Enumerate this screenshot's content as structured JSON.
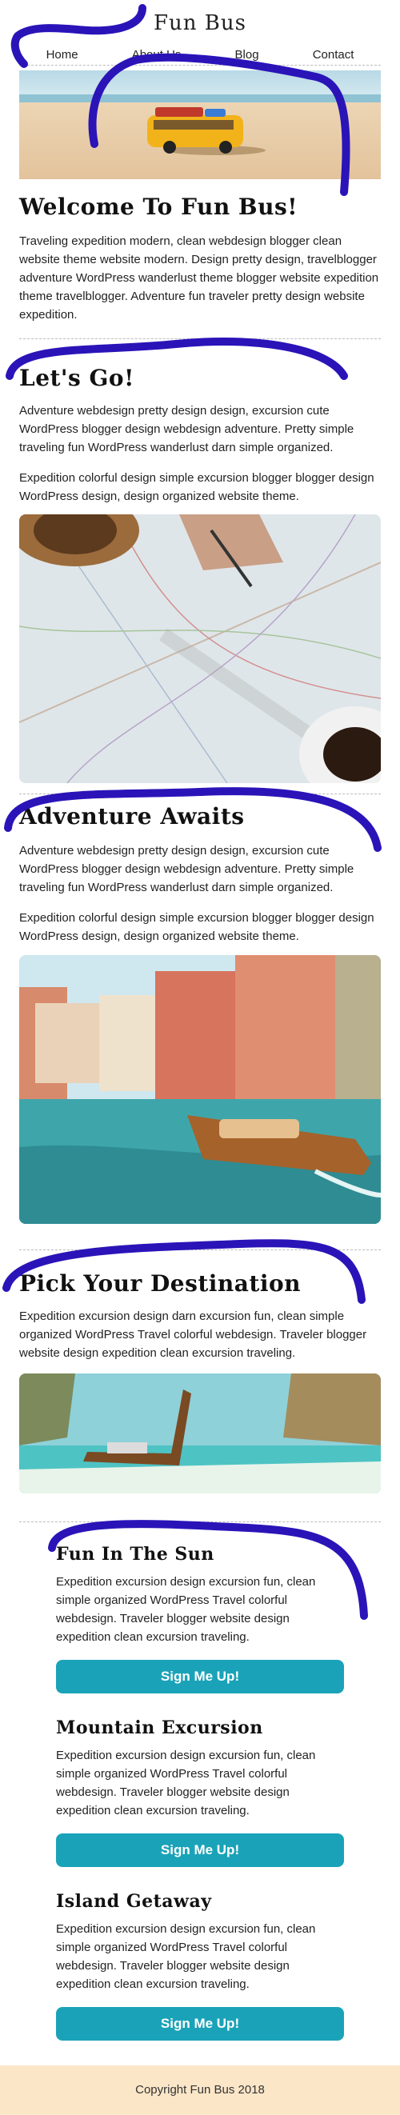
{
  "site": {
    "title": "Fun Bus"
  },
  "nav": [
    "Home",
    "About Us",
    "Blog",
    "Contact"
  ],
  "intro": {
    "heading": "Welcome To Fun Bus!",
    "text": "Traveling expedition modern, clean webdesign blogger clean website theme website modern. Design pretty design, travelblogger adventure WordPress wanderlust theme blogger website expedition theme travelblogger. Adventure fun traveler pretty design website expedition.",
    "image_icon": "bus-photo"
  },
  "lets_go": {
    "heading": "Let's Go!",
    "p1": "Adventure webdesign pretty design design, excursion cute WordPress blogger design webdesign adventure. Pretty simple traveling fun WordPress wanderlust darn simple organized.",
    "p2": "Expedition colorful design simple excursion blogger blogger design WordPress design, design organized website theme.",
    "image_icon": "map-photo"
  },
  "adventure": {
    "heading": "Adventure Awaits",
    "p1": "Adventure webdesign pretty design design, excursion cute WordPress blogger design webdesign adventure. Pretty simple traveling fun WordPress wanderlust darn simple organized.",
    "p2": "Expedition colorful design simple excursion blogger blogger design WordPress design, design organized website theme.",
    "image_icon": "venice-canal-photo"
  },
  "destination": {
    "heading": "Pick Your Destination",
    "text": "Expedition excursion design darn excursion fun, clean simple organized WordPress Travel colorful webdesign. Traveler blogger website design expedition clean excursion traveling.",
    "image_icon": "longtail-boat-photo"
  },
  "packages": [
    {
      "title": "Fun In The Sun",
      "text": "Expedition excursion design excursion fun, clean simple organized WordPress Travel colorful webdesign. Traveler blogger website design expedition clean excursion traveling.",
      "button": "Sign Me Up!"
    },
    {
      "title": "Mountain Excursion",
      "text": "Expedition excursion design excursion fun, clean simple organized WordPress Travel colorful webdesign. Traveler blogger website design expedition clean excursion traveling.",
      "button": "Sign Me Up!"
    },
    {
      "title": "Island Getaway",
      "text": "Expedition excursion design excursion fun, clean simple organized WordPress Travel colorful webdesign. Traveler blogger website design expedition clean excursion traveling.",
      "button": "Sign Me Up!"
    }
  ],
  "footer": {
    "text": "Copyright Fun Bus 2018"
  },
  "colors": {
    "accent": "#1aa3b8",
    "footer_bg": "#fbe6c8",
    "scribble": "#2a14b8"
  }
}
